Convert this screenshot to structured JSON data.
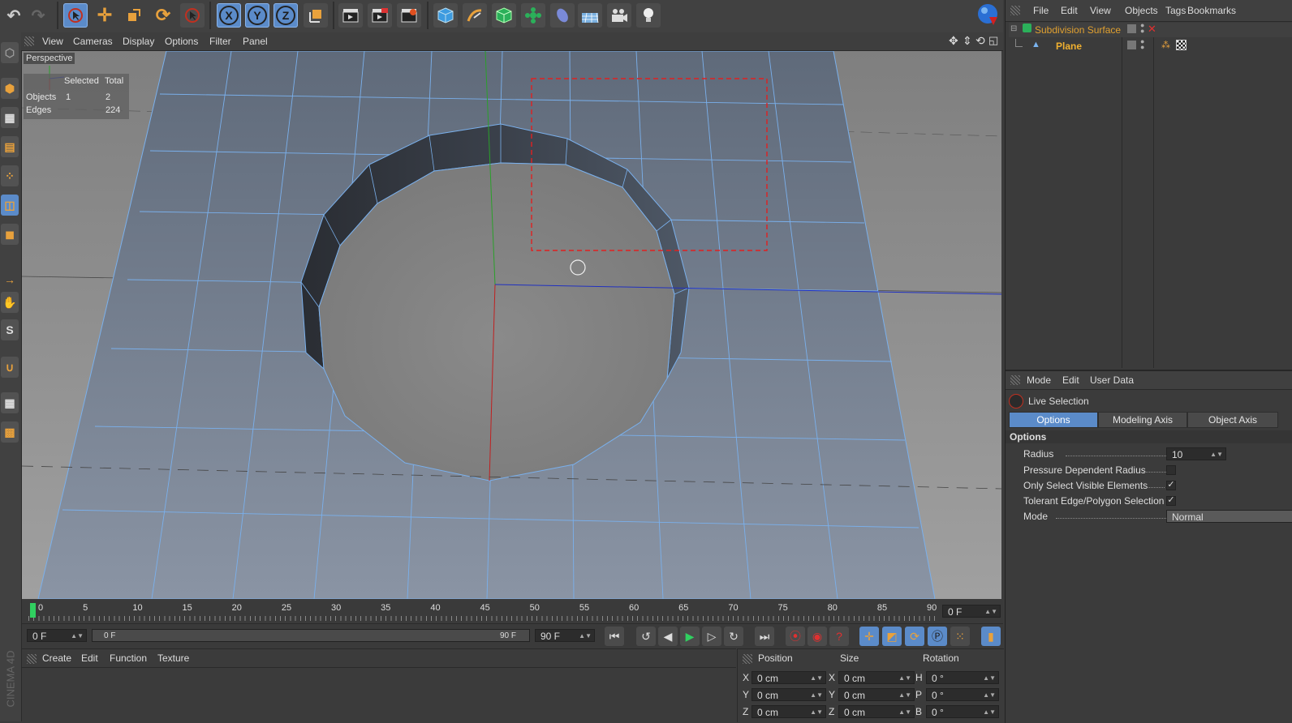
{
  "top_menu": {
    "file": "File",
    "edit": "Edit",
    "view": "View",
    "objects": "Objects",
    "tags": "Tags",
    "bookmarks": "Bookmarks"
  },
  "toolbar": {
    "axis_x": "X",
    "axis_y": "Y",
    "axis_z": "Z"
  },
  "viewport_menu": {
    "view": "View",
    "cameras": "Cameras",
    "display": "Display",
    "options": "Options",
    "filter": "Filter",
    "panel": "Panel"
  },
  "viewport": {
    "camera_label": "Perspective",
    "stats": {
      "col_selected": "Selected",
      "col_total": "Total",
      "rows": [
        {
          "label": "Objects",
          "selected": "1",
          "total": "2"
        },
        {
          "label": "Edges",
          "selected": "",
          "total": "224"
        }
      ]
    }
  },
  "object_manager": {
    "objects": [
      {
        "name": "Subdivision Surface",
        "color": "#e0a030"
      },
      {
        "name": "Plane",
        "color": "#f0b030"
      }
    ]
  },
  "attributes": {
    "menu": {
      "mode": "Mode",
      "edit": "Edit",
      "user_data": "User Data"
    },
    "tool_name": "Live Selection",
    "tabs": [
      "Options",
      "Modeling Axis",
      "Object Axis"
    ],
    "active_tab": "Options",
    "section": "Options",
    "radius_label": "Radius",
    "radius_value": "10",
    "pressure_label": "Pressure Dependent Radius",
    "pressure_checked": false,
    "visible_label": "Only Select Visible Elements",
    "visible_checked": true,
    "tolerant_label": "Tolerant Edge/Polygon Selection",
    "tolerant_checked": true,
    "mode_label": "Mode",
    "mode_value": "Normal"
  },
  "timeline": {
    "ticks": [
      "0",
      "5",
      "10",
      "15",
      "20",
      "25",
      "30",
      "35",
      "40",
      "45",
      "50",
      "55",
      "60",
      "65",
      "70",
      "75",
      "80",
      "85",
      "90"
    ],
    "current_frame": "0 F",
    "start_field": "0 F",
    "slider_left": "0 F",
    "slider_right": "90 F",
    "end_field": "90 F"
  },
  "material_manager": {
    "create": "Create",
    "edit": "Edit",
    "function": "Function",
    "texture": "Texture"
  },
  "coordinates": {
    "headers": {
      "position": "Position",
      "size": "Size",
      "rotation": "Rotation"
    },
    "rows": [
      {
        "axis": "X",
        "pos": "0 cm",
        "saxis": "X",
        "size": "0 cm",
        "raxis": "H",
        "rot": "0 °"
      },
      {
        "axis": "Y",
        "pos": "0 cm",
        "saxis": "Y",
        "size": "0 cm",
        "raxis": "P",
        "rot": "0 °"
      },
      {
        "axis": "Z",
        "pos": "0 cm",
        "saxis": "Z",
        "size": "0 cm",
        "raxis": "B",
        "rot": "0 °"
      }
    ]
  },
  "brand_vertical": "CINEMA 4D"
}
